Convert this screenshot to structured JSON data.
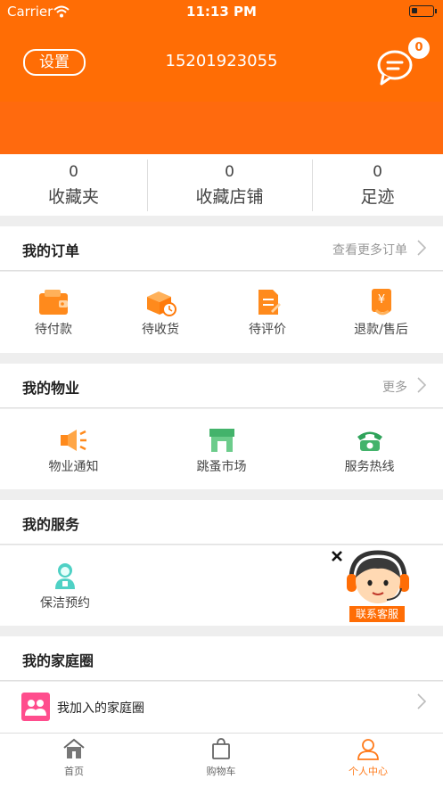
{
  "status_bar": {
    "carrier": "Carrier",
    "time": "11:13 PM"
  },
  "header": {
    "settings_label": "设置",
    "phone": "15201923055",
    "message_count": "0",
    "icon": "chat-bubble-icon",
    "accent": "#ff6d05"
  },
  "stats": [
    {
      "value": "0",
      "label": "收藏夹"
    },
    {
      "value": "0",
      "label": "收藏店铺"
    },
    {
      "value": "0",
      "label": "足迹"
    }
  ],
  "orders": {
    "title": "我的订单",
    "more": "查看更多订单",
    "items": [
      {
        "label": "待付款",
        "icon": "wallet-icon"
      },
      {
        "label": "待收货",
        "icon": "package-icon"
      },
      {
        "label": "待评价",
        "icon": "review-icon"
      },
      {
        "label": "退款/售后",
        "icon": "refund-icon"
      }
    ]
  },
  "property": {
    "title": "我的物业",
    "more": "更多",
    "items": [
      {
        "label": "物业通知",
        "icon": "megaphone-icon"
      },
      {
        "label": "跳蚤市场",
        "icon": "store-icon"
      },
      {
        "label": "服务热线",
        "icon": "telephone-icon"
      }
    ]
  },
  "services": {
    "title": "我的服务",
    "items": [
      {
        "label": "保洁预约",
        "icon": "cleaner-icon"
      }
    ],
    "support_label": "联系客服"
  },
  "family": {
    "title": "我的家庭圈",
    "row_label": "我加入的家庭圈"
  },
  "tabbar": {
    "items": [
      {
        "label": "首页",
        "icon": "home-icon"
      },
      {
        "label": "购物车",
        "icon": "cart-bag-icon"
      },
      {
        "label": "个人中心",
        "icon": "person-icon"
      }
    ],
    "active_color": "#ff7a1a"
  }
}
